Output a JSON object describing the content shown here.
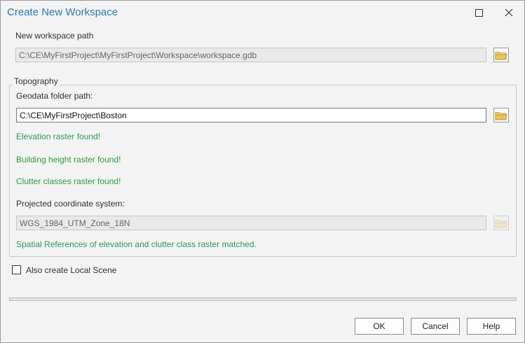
{
  "window": {
    "title": "Create New Workspace",
    "maximize_glyph": "☐",
    "close_glyph": "✕"
  },
  "workspace": {
    "label": "New workspace path",
    "path": "C:\\CE\\MyFirstProject\\MyFirstProject\\Workspace\\workspace.gdb"
  },
  "topography": {
    "group_label": "Topography",
    "geodata_label": "Geodata folder path:",
    "geodata_path": "C:\\CE\\MyFirstProject\\Boston",
    "status": {
      "elevation": "Elevation raster found!",
      "building_height": "Building height raster found!",
      "clutter_classes": "Clutter classes raster found!"
    },
    "coord_label": "Projected coordinate system:",
    "coord_value": "WGS_1984_UTM_Zone_18N",
    "match_message": "Spatial References of elevation and clutter class raster matched."
  },
  "local_scene": {
    "label": "Also create Local Scene",
    "checked": false
  },
  "progress": {
    "value": 0
  },
  "buttons": {
    "ok": "OK",
    "cancel": "Cancel",
    "help": "Help"
  },
  "colors": {
    "title": "#2a7ab0",
    "status_green": "#2e9a48",
    "folder_yellow": "#e8c45a"
  }
}
